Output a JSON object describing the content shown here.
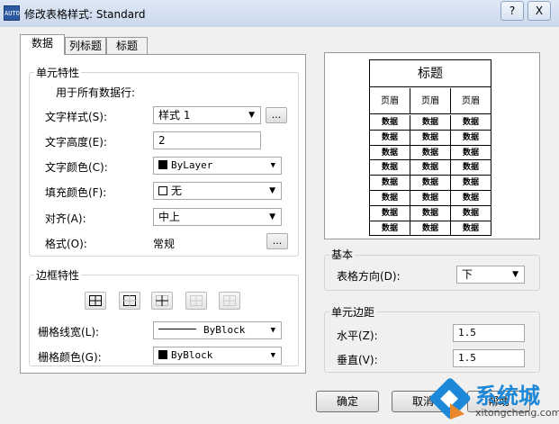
{
  "window": {
    "icon_text": "AUTO",
    "title": "修改表格样式: Standard",
    "help_label": "?",
    "close_label": "X"
  },
  "tabs": [
    {
      "label": "数据"
    },
    {
      "label": "列标题"
    },
    {
      "label": "标题"
    }
  ],
  "cell_props": {
    "group_label": "单元特性",
    "apply_all_label": "用于所有数据行:",
    "text_style": {
      "label": "文字样式(S):",
      "value": "样式 1",
      "dots": "..."
    },
    "text_height": {
      "label": "文字高度(E):",
      "value": "2"
    },
    "text_color": {
      "label": "文字颜色(C):",
      "value": "ByLayer",
      "swatch": "#000000"
    },
    "fill_color": {
      "label": "填充颜色(F):",
      "value": "无",
      "swatch": "#ffffff"
    },
    "align": {
      "label": "对齐(A):",
      "value": "中上"
    },
    "format": {
      "label": "格式(O):",
      "value": "常规",
      "dots": "..."
    }
  },
  "border_props": {
    "group_label": "边框特性",
    "line_weight": {
      "label": "栅格线宽(L):",
      "value": "ByBlock"
    },
    "line_color": {
      "label": "栅格颜色(G):",
      "value": "ByBlock",
      "swatch": "#000000"
    }
  },
  "preview": {
    "title": "标题",
    "header": [
      "页眉",
      "页眉",
      "页眉"
    ],
    "rows": [
      [
        "数据",
        "数据",
        "数据"
      ],
      [
        "数据",
        "数据",
        "数据"
      ],
      [
        "数据",
        "数据",
        "数据"
      ],
      [
        "数据",
        "数据",
        "数据"
      ],
      [
        "数据",
        "数据",
        "数据"
      ],
      [
        "数据",
        "数据",
        "数据"
      ],
      [
        "数据",
        "数据",
        "数据"
      ],
      [
        "数据",
        "数据",
        "数据"
      ]
    ]
  },
  "basic": {
    "group_label": "基本",
    "direction": {
      "label": "表格方向(D):",
      "value": "下"
    }
  },
  "margins": {
    "group_label": "单元边距",
    "horizontal": {
      "label": "水平(Z):",
      "value": "1.5"
    },
    "vertical": {
      "label": "垂直(V):",
      "value": "1.5"
    }
  },
  "buttons": {
    "ok": "确定",
    "cancel": "取消",
    "help": "帮助"
  },
  "watermark": {
    "brand": "系统城",
    "url": "xitongcheng.com"
  },
  "colors": {
    "accent": "#1e88d8",
    "logo_orange": "#e8862a"
  }
}
